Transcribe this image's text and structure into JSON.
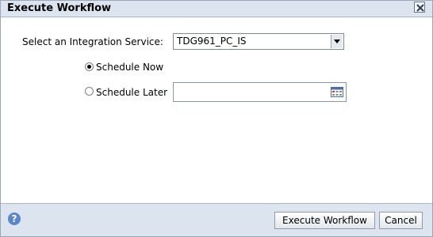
{
  "dialog": {
    "title": "Execute Workflow",
    "close_icon": "close-icon",
    "help_icon": "help-icon",
    "help_glyph": "?"
  },
  "form": {
    "integration_service_label": "Select an Integration Service:",
    "integration_service_value": "TDG961_PC_IS",
    "schedule_now_label": "Schedule Now",
    "schedule_now_checked": true,
    "schedule_later_label": "Schedule Later",
    "schedule_later_checked": false,
    "schedule_later_value": "",
    "calendar_icon": "calendar-icon"
  },
  "buttons": {
    "execute_label": "Execute Workflow",
    "cancel_label": "Cancel"
  },
  "colors": {
    "dialog_bg": "#dbe4ef",
    "content_bg": "#ffffff",
    "help_blue": "#5b86c7"
  }
}
